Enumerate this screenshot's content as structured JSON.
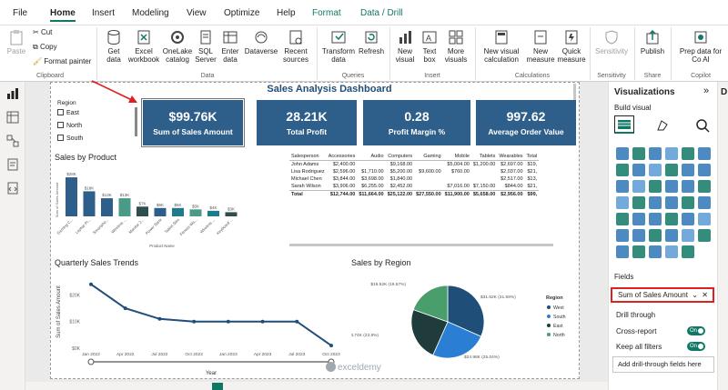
{
  "menu": {
    "tabs": [
      "File",
      "Home",
      "Insert",
      "Modeling",
      "View",
      "Optimize",
      "Help",
      "Format",
      "Data / Drill"
    ]
  },
  "ribbon": {
    "clipboard": {
      "paste": "Paste",
      "cut": "Cut",
      "copy": "Copy",
      "format_painter": "Format painter",
      "label": "Clipboard"
    },
    "data": {
      "get_data": "Get data",
      "excel": "Excel workbook",
      "onelake": "OneLake catalog",
      "sql": "SQL Server",
      "enter": "Enter data",
      "dataverse": "Dataverse",
      "recent": "Recent sources",
      "label": "Data"
    },
    "queries": {
      "transform": "Transform data",
      "refresh": "Refresh",
      "label": "Queries"
    },
    "insert": {
      "new_visual": "New visual",
      "text_box": "Text box",
      "more_visuals": "More visuals",
      "label": "Insert"
    },
    "calculations": {
      "new_visual_calc": "New visual calculation",
      "new_measure": "New measure",
      "quick_measure": "Quick measure",
      "label": "Calculations"
    },
    "sensitivity": {
      "sensitivity": "Sensitivity",
      "label": "Sensitivity"
    },
    "share": {
      "publish": "Publish",
      "label": "Share"
    },
    "copilot": {
      "prep": "Prep data for Co AI",
      "label": "Copilot"
    }
  },
  "report": {
    "title": "Sales Analysis Dashboard",
    "slicer": {
      "title": "Region",
      "items": [
        "East",
        "North",
        "South"
      ]
    },
    "kpis": [
      {
        "value": "$99.76K",
        "label": "Sum of Sales Amount"
      },
      {
        "value": "28.21K",
        "label": "Total Profit"
      },
      {
        "value": "0.28",
        "label": "Profit Margin %"
      },
      {
        "value": "997.62",
        "label": "Average Order Value"
      }
    ],
    "matrix": {
      "headers": [
        "Salesperson",
        "Accessories",
        "Audio",
        "Computers",
        "Gaming",
        "Mobile",
        "Tablets",
        "Wearables",
        "Total"
      ],
      "rows": [
        [
          "John Adams",
          "$2,400.00",
          "",
          "$9,168.00",
          "",
          "$5,004.00",
          "$1,200.00",
          "$2,697.00",
          "$19,"
        ],
        [
          "Lisa Rodriguez",
          "$2,596.00",
          "$1,710.00",
          "$5,200.00",
          "$9,600.00",
          "$760.00",
          "",
          "$2,037.00",
          "$21,"
        ],
        [
          "Michael Chen",
          "$3,844.00",
          "$3,698.00",
          "$1,840.00",
          "",
          "",
          "",
          "$2,517.00",
          "$13,"
        ],
        [
          "Sarah Wilson",
          "$3,906.00",
          "$6,255.00",
          "$2,452.00",
          "",
          "$7,016.00",
          "$7,150.00",
          "$844.00",
          "$21,"
        ],
        [
          "Total",
          "$12,744.00",
          "$11,664.00",
          "$25,122.00",
          "$27,550.00",
          "$11,900.00",
          "$5,658.00",
          "$2,956.00",
          "$99,"
        ]
      ]
    },
    "watermark": "exceldemy"
  },
  "chart_data": [
    {
      "type": "bar",
      "title": "Sales by Product",
      "xlabel": "Product Name",
      "ylabel": "Sum of Sales Amount",
      "categories": [
        "Gaming C...",
        "Laptop Pr...",
        "Smartpho...",
        "Wireless ...",
        "Monitor 2...",
        "Power Bank",
        "Tablet Slim",
        "Fitness Wa...",
        "Wireless ...",
        "Keyboard ..."
      ],
      "values": [
        28,
        18,
        13,
        13,
        7,
        6,
        6,
        5,
        4,
        3
      ],
      "data_labels": [
        "$28K",
        "$18K",
        "$13K",
        "$13K",
        "$7K",
        "$6K",
        "$6K",
        "$5K",
        "$4K",
        "$3K"
      ],
      "colors": [
        "#2e5f8a",
        "#2e5f8a",
        "#2e5f8a",
        "#4a9a88",
        "#2f4f4f",
        "#2e5f8a",
        "#1f7a8c",
        "#4a9a88",
        "#1f7a8c",
        "#2f4f4f"
      ]
    },
    {
      "type": "line",
      "title": "Quarterly Sales Trends",
      "xlabel": "Year",
      "ylabel": "Sum of Sales Amount",
      "x": [
        "Jan 2022",
        "Apr 2022",
        "Jul 2022",
        "Oct 2022",
        "Jan 2023",
        "Apr 2023",
        "Jul 2023",
        "Oct 2023"
      ],
      "y": [
        24,
        15,
        11,
        10,
        10,
        10,
        10,
        1
      ],
      "ytick_labels": [
        "$0K",
        "$10K",
        "$20K"
      ],
      "ylim": [
        0,
        28
      ],
      "color": "#1f4e79"
    },
    {
      "type": "pie",
      "title": "Sales by Region",
      "legend_title": "Region",
      "categories": [
        "West",
        "South",
        "East",
        "North"
      ],
      "labels": [
        "$31.52K (31.59%)",
        "$24.98K (25.04%)",
        "$23.74K (23.8%)",
        "$19.52K (19.57%)"
      ],
      "values": [
        31.52,
        24.98,
        23.74,
        19.52
      ],
      "colors": [
        "#1f4e79",
        "#2a7fd4",
        "#1f3b3b",
        "#4a9e6b"
      ]
    }
  ],
  "viz": {
    "title": "Visualizations",
    "build": "Build visual",
    "fields_label": "Fields",
    "field_value": "Sum of Sales Amount",
    "drill": "Drill through",
    "cross_report": "Cross-report",
    "keep_filters": "Keep all filters",
    "on": "On",
    "add_drill": "Add drill-through fields here",
    "collapse": "»"
  },
  "data_pane": {
    "initial": "D"
  }
}
